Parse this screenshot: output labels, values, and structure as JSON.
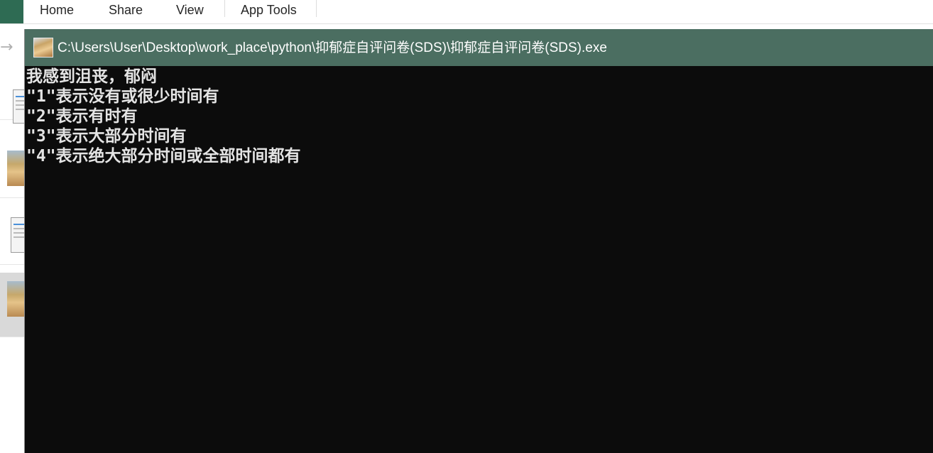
{
  "explorer": {
    "ribbon_tabs": [
      {
        "label": "Home"
      },
      {
        "label": "Share"
      },
      {
        "label": "View"
      },
      {
        "label": "App Tools"
      }
    ],
    "back_arrow": "→"
  },
  "console": {
    "title": "C:\\Users\\User\\Desktop\\work_place\\python\\抑郁症自评问卷(SDS)\\抑郁症自评问卷(SDS).exe",
    "lines": [
      "我感到沮丧，郁闷",
      "\"1\"表示没有或很少时间有",
      "\"2\"表示有时有",
      "\"3\"表示大部分时间有",
      "\"4\"表示绝大部分时间或全部时间都有"
    ]
  },
  "icons": {
    "app_icon": "dog-photo-icon",
    "arrow": "forward-arrow-icon"
  },
  "colors": {
    "titlebar": "#4b6e61",
    "console_bg": "#0c0c0c",
    "console_text": "#e4e4e4",
    "file_tab": "#2e6b53"
  }
}
